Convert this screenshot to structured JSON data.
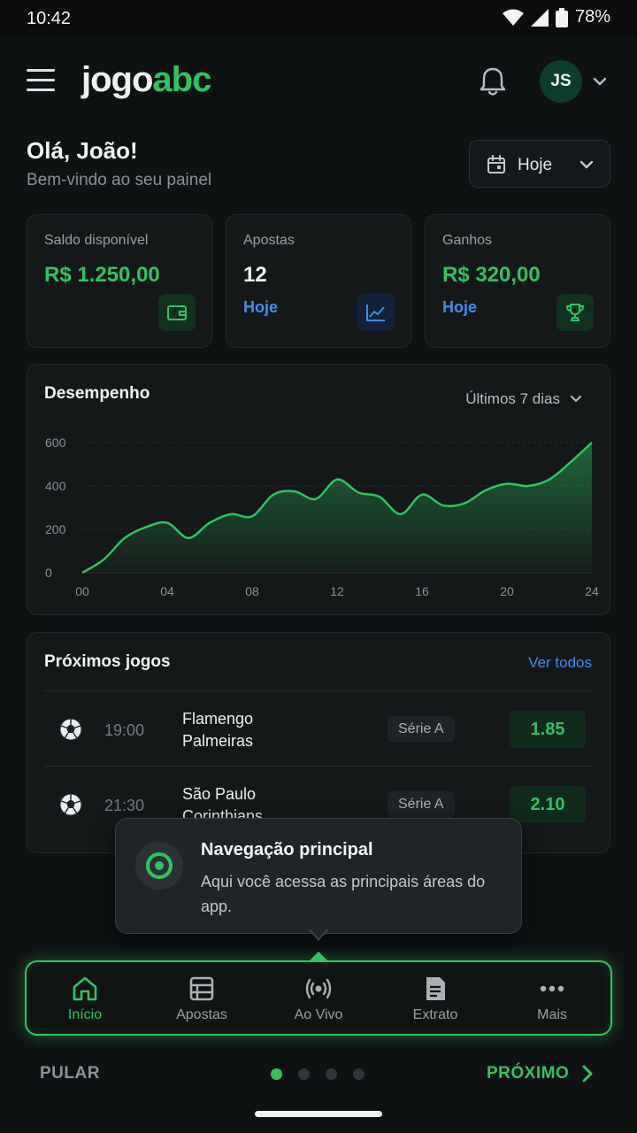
{
  "status_bar": {
    "time": "10:42",
    "battery": "78%"
  },
  "header": {
    "logo_part1": "jogo",
    "logo_part2": "abc",
    "avatar_initials": "JS"
  },
  "greeting": {
    "title": "Olá, João!",
    "subtitle": "Bem-vindo ao seu painel",
    "date_filter": "Hoje"
  },
  "stats": [
    {
      "label": "Saldo disponível",
      "value": "R$ 1.250,00",
      "sub": "",
      "icon": "wallet-icon"
    },
    {
      "label": "Apostas",
      "value": "12",
      "sub": "Hoje",
      "icon": "line-chart-icon"
    },
    {
      "label": "Ganhos",
      "value": "R$ 320,00",
      "sub": "Hoje",
      "icon": "trophy-icon"
    }
  ],
  "performance": {
    "title": "Desempenho",
    "range": "Últimos 7 dias"
  },
  "chart_data": {
    "type": "area",
    "title": "Desempenho",
    "x": [
      0,
      1,
      2,
      3,
      4,
      5,
      6,
      7,
      8,
      9,
      10,
      11,
      12,
      13,
      14,
      15,
      16,
      17,
      18,
      19,
      20,
      21,
      22,
      23,
      24
    ],
    "values": [
      0,
      60,
      160,
      210,
      230,
      160,
      230,
      270,
      260,
      360,
      375,
      340,
      430,
      370,
      350,
      270,
      360,
      310,
      320,
      380,
      410,
      400,
      430,
      510,
      600
    ],
    "xticks": [
      "00",
      "04",
      "08",
      "12",
      "16",
      "20",
      "24"
    ],
    "yticks": [
      "0",
      "200",
      "400",
      "600"
    ],
    "xlim": [
      0,
      24
    ],
    "ylim": [
      0,
      600
    ],
    "grid": true,
    "color": "#2fc45f"
  },
  "games": {
    "title": "Próximos jogos",
    "see_all": "Ver todos",
    "rows": [
      {
        "time": "19:00",
        "team1": "Flamengo",
        "team2": "Palmeiras",
        "league": "Série A",
        "odd": "1.85"
      },
      {
        "time": "21:30",
        "team1": "São Paulo",
        "team2": "Corinthians",
        "league": "Série A",
        "odd": "2.10"
      }
    ]
  },
  "tooltip": {
    "title": "Navegação principal",
    "text": "Aqui você acessa as principais áreas do app."
  },
  "nav": [
    {
      "label": "Início",
      "icon": "home-icon",
      "active": true
    },
    {
      "label": "Apostas",
      "icon": "list-icon",
      "active": false
    },
    {
      "label": "Ao Vivo",
      "icon": "live-broadcast-icon",
      "active": false
    },
    {
      "label": "Extrato",
      "icon": "statement-icon",
      "active": false
    },
    {
      "label": "Mais",
      "icon": "more-icon",
      "active": false
    }
  ],
  "onboarding": {
    "skip": "PULAR",
    "next": "PRÓXIMO",
    "steps": 4,
    "current": 1
  },
  "colors": {
    "accent": "#2fc45f",
    "link": "#3b8fe8",
    "background": "#0f1213"
  }
}
